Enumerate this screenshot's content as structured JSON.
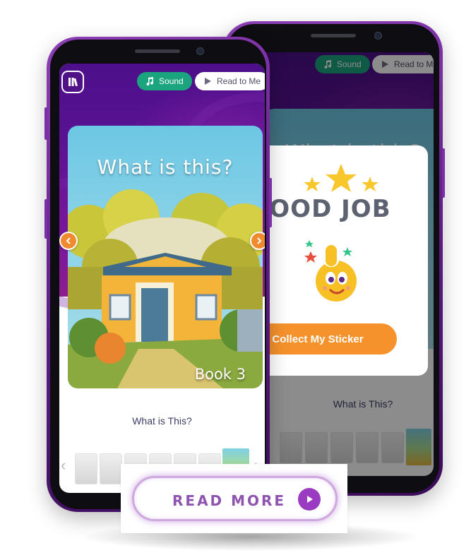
{
  "controls": {
    "sound_label": "Sound",
    "read_to_me_label": "Read to Me"
  },
  "book": {
    "cover_title": "What is this?",
    "book_number_label": "Book 3",
    "caption": "What is This?"
  },
  "reward_modal": {
    "headline": "GOOD JOB",
    "collect_button_label": "Collect My Sticker",
    "behind_title_partial": "What is this?"
  },
  "cta": {
    "read_more_label": "READ MORE"
  },
  "colors": {
    "header_purple": "#5d1396",
    "sound_green": "#1aa57e",
    "accent_orange": "#f6922c",
    "cta_purple": "#9a3bc2"
  }
}
